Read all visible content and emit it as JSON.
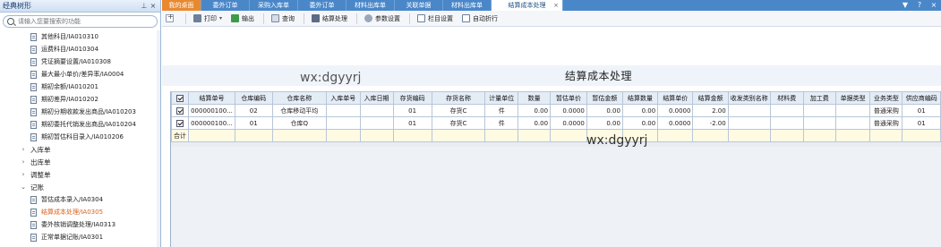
{
  "sidebar": {
    "title": "经典树形",
    "search_placeholder": "请输入您要搜索的功能",
    "items": [
      {
        "type": "doc",
        "label": "其他科目/IA010310"
      },
      {
        "type": "doc",
        "label": "运费科目/IA010304"
      },
      {
        "type": "doc",
        "label": "凭证摘要设置/IA010308"
      },
      {
        "type": "doc",
        "label": "最大最小单价/差异率/IA0004"
      },
      {
        "type": "doc",
        "label": "期初余额/IA010201"
      },
      {
        "type": "doc",
        "label": "期初差异/IA010202"
      },
      {
        "type": "doc",
        "label": "期初分期收款发出商品/IA010203"
      },
      {
        "type": "doc",
        "label": "期初委托代销发出商品/IA010204"
      },
      {
        "type": "doc",
        "label": "期初暂估科目录入/IA010206"
      },
      {
        "type": "group",
        "arrow": "›",
        "label": "入库单"
      },
      {
        "type": "group",
        "arrow": "›",
        "label": "出库单"
      },
      {
        "type": "group",
        "arrow": "›",
        "label": "调整单"
      },
      {
        "type": "group",
        "arrow": "⌄",
        "label": "记账"
      },
      {
        "type": "doc",
        "label": "暂估成本录入/IA0304"
      },
      {
        "type": "doc",
        "label": "结算成本处理/IA0305",
        "active": true
      },
      {
        "type": "doc",
        "label": "委外核销调整处理/IA0313"
      },
      {
        "type": "doc",
        "label": "正常单据记账/IA0301"
      }
    ]
  },
  "tabs": [
    "我的桌面",
    "委外订单",
    "采购入库单",
    "委外订单",
    "材料出库单",
    "关联单据",
    "材料出库单",
    "结算成本处理"
  ],
  "tab_close": "×",
  "window_controls": [
    "▼",
    "?",
    "×"
  ],
  "toolbar": {
    "print": "打印",
    "print_dropdown": "▾",
    "export": "输出",
    "query": "查询",
    "settle": "结算处理",
    "params": "参数设置",
    "columns": "栏目设置",
    "wrap": "自动折行"
  },
  "page_title": "结算成本处理",
  "watermark": "wx:dgyyrj",
  "grid": {
    "columns": [
      "结算单号",
      "仓库编码",
      "仓库名称",
      "入库单号",
      "入库日期",
      "存货编码",
      "存货名称",
      "计量单位",
      "数量",
      "暂估单价",
      "暂估金额",
      "结算数量",
      "结算单价",
      "结算金额",
      "收发类别名称",
      "材料费",
      "加工费",
      "单据类型",
      "业务类型",
      "供应商编码"
    ],
    "rows": [
      {
        "checked": true,
        "cells": [
          "000000100...",
          "02",
          "仓库移动平均",
          "",
          "",
          "01",
          "存货C",
          "件",
          "0.00",
          "0.0000",
          "0.00",
          "0.00",
          "0.0000",
          "2.00",
          "",
          "",
          "",
          "",
          "普通采购",
          "01"
        ]
      },
      {
        "checked": true,
        "cells": [
          "000000100...",
          "01",
          "仓库Q",
          "",
          "",
          "01",
          "存货C",
          "件",
          "0.00",
          "0.0000",
          "0.00",
          "0.00",
          "0.0000",
          "-2.00",
          "",
          "",
          "",
          "",
          "普通采购",
          "01"
        ]
      }
    ],
    "total_label": "合计"
  },
  "colors": {
    "tab_bar": "#4a87c9",
    "home_tab": "#e8892f",
    "active_tree": "#d8621f"
  }
}
